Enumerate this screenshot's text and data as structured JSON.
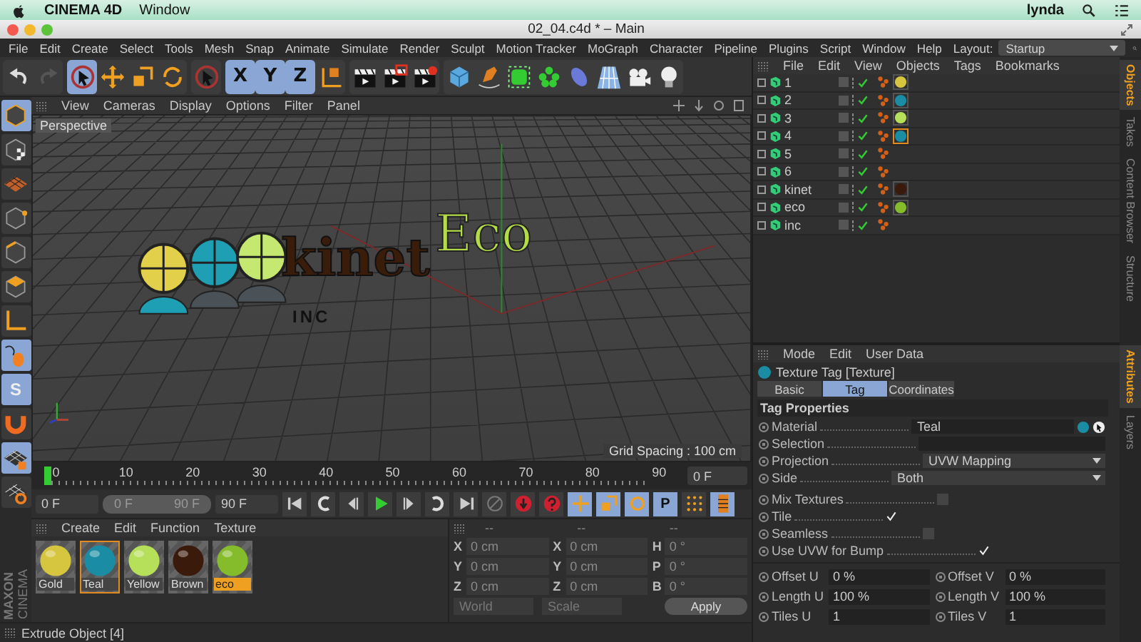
{
  "mac_menubar": {
    "app": "CINEMA 4D",
    "menus": [
      "Window"
    ],
    "user": "lynda"
  },
  "window": {
    "title": "02_04.c4d * – Main"
  },
  "menu": [
    "File",
    "Edit",
    "Create",
    "Select",
    "Tools",
    "Mesh",
    "Snap",
    "Animate",
    "Simulate",
    "Render",
    "Sculpt",
    "Motion Tracker",
    "MoGraph",
    "Character",
    "Pipeline",
    "Plugins",
    "Script",
    "Window",
    "Help"
  ],
  "layout": {
    "label": "Layout:",
    "value": "Startup"
  },
  "toolbar": [
    [
      {
        "kind": "undo",
        "selected": false
      },
      {
        "kind": "redo",
        "selected": false
      }
    ],
    [
      {
        "kind": "select",
        "selected": true
      },
      {
        "kind": "move",
        "selected": false
      },
      {
        "kind": "scale",
        "selected": false
      },
      {
        "kind": "rotate",
        "selected": false
      }
    ],
    [
      {
        "kind": "live",
        "selected": false
      }
    ],
    [
      {
        "kind": "axis",
        "label": "X",
        "selected": true
      },
      {
        "kind": "axis",
        "label": "Y",
        "selected": true
      },
      {
        "kind": "axis",
        "label": "Z",
        "selected": true
      },
      {
        "kind": "coord",
        "selected": false
      }
    ],
    [
      {
        "kind": "render-view",
        "selected": false
      },
      {
        "kind": "render-picture",
        "selected": false
      },
      {
        "kind": "render-settings",
        "selected": false
      }
    ],
    [
      {
        "kind": "cube",
        "selected": false
      },
      {
        "kind": "pen",
        "selected": false
      },
      {
        "kind": "subdivision",
        "selected": false
      },
      {
        "kind": "cloner",
        "selected": false
      },
      {
        "kind": "deformer",
        "selected": false
      },
      {
        "kind": "floor",
        "selected": false
      },
      {
        "kind": "camera",
        "selected": false
      },
      {
        "kind": "light",
        "selected": false
      }
    ]
  ],
  "left_tools": [
    {
      "kind": "model",
      "selected": true
    },
    {
      "kind": "texture",
      "selected": false
    },
    {
      "kind": "workplane",
      "selected": false
    },
    {
      "kind": "points",
      "selected": false
    },
    {
      "kind": "edges",
      "selected": false
    },
    {
      "kind": "polygons",
      "selected": false
    },
    {
      "kind": "axis-mode",
      "selected": false
    },
    {
      "kind": "tweak",
      "selected": true
    },
    {
      "kind": "snap",
      "label": "S",
      "selected": true
    },
    {
      "kind": "magnet",
      "selected": false
    },
    {
      "kind": "lock",
      "selected": true
    },
    {
      "kind": "planar",
      "selected": false
    }
  ],
  "brand": [
    "MAXON",
    "CINEMA"
  ],
  "viewport": {
    "menu": [
      "View",
      "Cameras",
      "Display",
      "Options",
      "Filter",
      "Panel"
    ],
    "label": "Perspective",
    "grid_spacing": "Grid Spacing : 100 cm",
    "logo": {
      "word_1": "kinet",
      "word_2": "Eco",
      "subtitle": "INC"
    }
  },
  "timeline": {
    "ticks": [
      "0",
      "10",
      "20",
      "30",
      "40",
      "50",
      "60",
      "70",
      "80",
      "90"
    ],
    "level": 0,
    "frame": "0 F"
  },
  "playback": {
    "start": "0 F",
    "range": {
      "start": "0 F",
      "end": "90 F",
      "level": 1
    },
    "end": "90 F",
    "buttons": [
      {
        "kind": "to-start",
        "selected": false
      },
      {
        "kind": "prev-key",
        "selected": false
      },
      {
        "kind": "prev-frame",
        "selected": false
      },
      {
        "kind": "play",
        "selected": false
      },
      {
        "kind": "next-frame",
        "selected": false
      },
      {
        "kind": "next-key",
        "selected": false
      },
      {
        "kind": "to-end",
        "selected": false
      },
      {
        "kind": "record",
        "selected": false
      },
      {
        "kind": "autokey",
        "selected": false
      },
      {
        "kind": "keysel",
        "selected": false
      },
      {
        "kind": "key-move",
        "selected": true
      },
      {
        "kind": "key-scale",
        "selected": true
      },
      {
        "kind": "key-rotate",
        "selected": true
      },
      {
        "kind": "key-param",
        "label": "P",
        "selected": true
      },
      {
        "kind": "key-pla",
        "selected": false
      },
      {
        "kind": "timeline",
        "selected": true
      }
    ]
  },
  "materials": {
    "menu": [
      "Create",
      "Edit",
      "Function",
      "Texture"
    ],
    "items": [
      {
        "name": "Gold",
        "color": "#d6c53e",
        "selected": false,
        "highlighted": false
      },
      {
        "name": "Teal",
        "color": "#1a8ca4",
        "selected": true,
        "highlighted": false
      },
      {
        "name": "Yellow",
        "color": "#b6df5a",
        "selected": false,
        "highlighted": false
      },
      {
        "name": "Brown",
        "color": "#3a1a0a",
        "selected": false,
        "highlighted": false
      },
      {
        "name": "eco",
        "color": "#84bc2c",
        "selected": false,
        "highlighted": true
      }
    ]
  },
  "coordinates": {
    "columns": [
      {
        "header": "--",
        "fields": [
          {
            "axis": "X",
            "value": "0 cm"
          },
          {
            "axis": "Y",
            "value": "0 cm"
          },
          {
            "axis": "Z",
            "value": "0 cm"
          }
        ]
      },
      {
        "header": "--",
        "fields": [
          {
            "axis": "X",
            "value": "0 cm"
          },
          {
            "axis": "Y",
            "value": "0 cm"
          },
          {
            "axis": "Z",
            "value": "0 cm"
          }
        ]
      },
      {
        "header": "--",
        "fields": [
          {
            "axis": "H",
            "value": "0 °"
          },
          {
            "axis": "P",
            "value": "0 °"
          },
          {
            "axis": "B",
            "value": "0 °"
          }
        ]
      }
    ],
    "disabled": true,
    "dropdowns": [
      "World",
      "Scale"
    ],
    "apply": "Apply"
  },
  "status": "Extrude Object [4]",
  "objects": {
    "menu": [
      "File",
      "Edit",
      "View",
      "Objects",
      "Tags",
      "Bookmarks"
    ],
    "rows": [
      {
        "name": "1",
        "tags": [
          {
            "color": "#d6c53e",
            "selected": false
          }
        ]
      },
      {
        "name": "2",
        "tags": [
          {
            "color": "#1a8ca4",
            "selected": false
          }
        ]
      },
      {
        "name": "3",
        "tags": [
          {
            "color": "#b6df5a",
            "selected": false
          }
        ]
      },
      {
        "name": "4",
        "tags": [
          {
            "color": "#1a8ca4",
            "selected": true
          }
        ]
      },
      {
        "name": "5",
        "tags": []
      },
      {
        "name": "6",
        "tags": []
      },
      {
        "name": "kinet",
        "tags": [
          {
            "color": "#3a1a0a",
            "selected": false
          }
        ]
      },
      {
        "name": "eco",
        "tags": [
          {
            "color": "#84bc2c",
            "selected": false
          }
        ]
      },
      {
        "name": "inc",
        "tags": []
      }
    ]
  },
  "attributes": {
    "menu": [
      "Mode",
      "Edit",
      "User Data"
    ],
    "title": "Texture Tag [Texture]",
    "tabs": [
      {
        "label": "Basic",
        "selected": false
      },
      {
        "label": "Tag",
        "selected": true
      },
      {
        "label": "Coordinates",
        "selected": false
      }
    ],
    "section": "Tag Properties",
    "fields": [
      {
        "kind": "link",
        "label": "Material",
        "value": "Teal"
      },
      {
        "kind": "text",
        "label": "Selection"
      },
      {
        "kind": "dropdown",
        "label": "Projection",
        "value": "UVW Mapping"
      },
      {
        "kind": "dropdown",
        "label": "Side",
        "value": "Both"
      },
      {
        "kind": "checkbox",
        "label": "Mix Textures",
        "checked": false
      },
      {
        "kind": "checkbox",
        "label": "Tile",
        "checked": true
      },
      {
        "kind": "checkbox",
        "label": "Seamless",
        "checked": false
      },
      {
        "kind": "checkbox",
        "label": "Use UVW for Bump",
        "checked": true
      }
    ],
    "pairs": [
      {
        "label": "Offset U",
        "value": "0 %"
      },
      {
        "label": "Offset V",
        "value": "0 %"
      },
      {
        "label": "Length U",
        "value": "100 %"
      },
      {
        "label": "Length V",
        "value": "100 %"
      },
      {
        "label": "Tiles U",
        "value": "1"
      },
      {
        "label": "Tiles V",
        "value": "1"
      }
    ]
  },
  "side_tabs_top": [
    {
      "label": "Objects",
      "selected": true
    },
    {
      "label": "Takes",
      "selected": false
    },
    {
      "label": "Content Browser",
      "selected": false
    },
    {
      "label": "Structure",
      "selected": false
    }
  ],
  "side_tabs_bottom": [
    {
      "label": "Attributes",
      "selected": true
    },
    {
      "label": "Layers",
      "selected": false
    }
  ]
}
